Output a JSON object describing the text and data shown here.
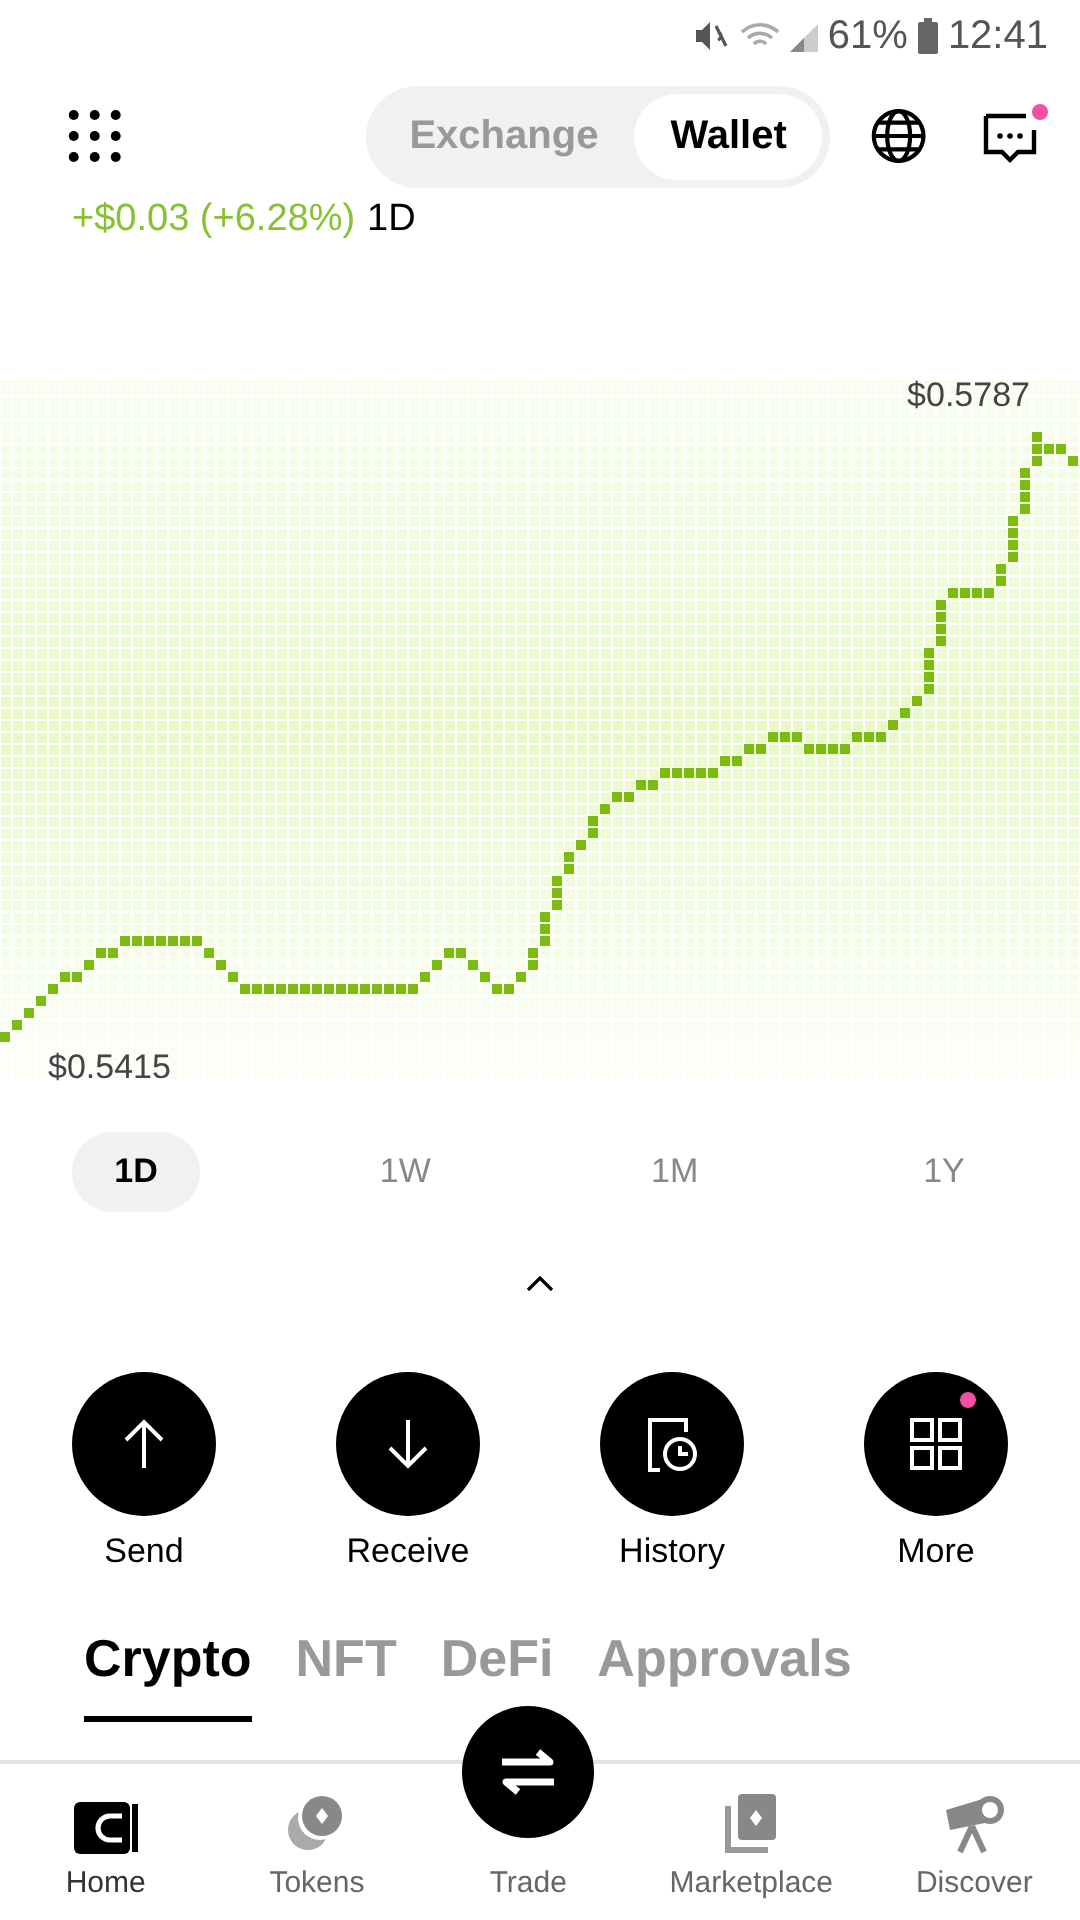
{
  "status_bar": {
    "battery": "61%",
    "time": "12:41"
  },
  "header": {
    "segments": [
      {
        "label": "Exchange",
        "selected": false
      },
      {
        "label": "Wallet",
        "selected": true
      }
    ],
    "messages_unread": true
  },
  "price_change": {
    "change": "+$0.03 (+6.28%)",
    "period": "1D"
  },
  "chart": {
    "high_label": "$0.5787",
    "low_label": "$0.5415"
  },
  "periods": [
    {
      "label": "1D",
      "selected": true
    },
    {
      "label": "1W",
      "selected": false
    },
    {
      "label": "1M",
      "selected": false
    },
    {
      "label": "1Y",
      "selected": false
    }
  ],
  "actions": [
    {
      "label": "Send",
      "kind": "send",
      "badge": false
    },
    {
      "label": "Receive",
      "kind": "receive",
      "badge": false
    },
    {
      "label": "History",
      "kind": "history",
      "badge": false
    },
    {
      "label": "More",
      "kind": "more",
      "badge": true
    }
  ],
  "asset_tabs": [
    {
      "label": "Crypto",
      "selected": true
    },
    {
      "label": "NFT",
      "selected": false
    },
    {
      "label": "DeFi",
      "selected": false
    },
    {
      "label": "Approvals",
      "selected": false
    }
  ],
  "nav": [
    {
      "label": "Home",
      "kind": "home",
      "selected": true
    },
    {
      "label": "Tokens",
      "kind": "tokens",
      "selected": false
    },
    {
      "label": "Trade",
      "kind": "trade",
      "selected": false
    },
    {
      "label": "Marketplace",
      "kind": "marketplace",
      "selected": false
    },
    {
      "label": "Discover",
      "kind": "discover",
      "selected": false
    }
  ]
}
